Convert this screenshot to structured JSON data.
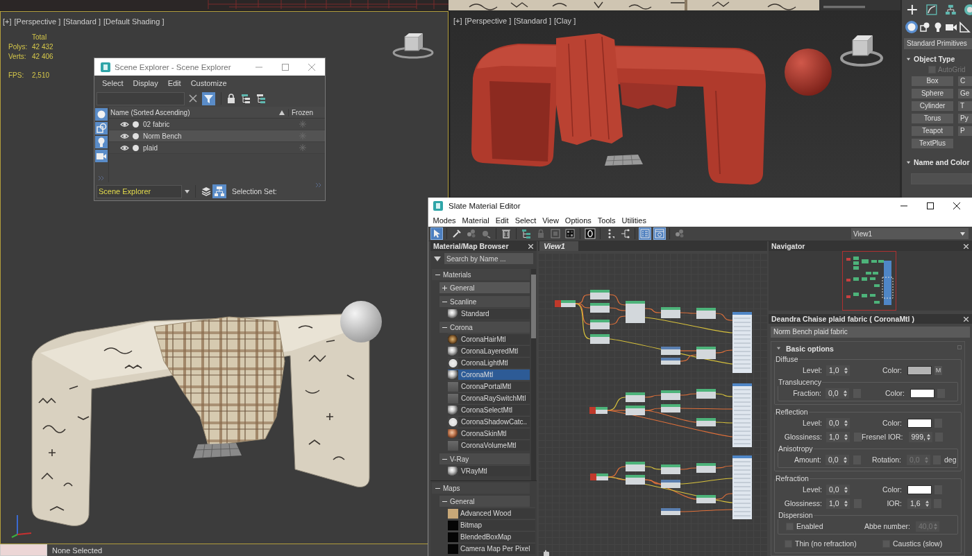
{
  "left_viewport": {
    "labels": [
      "[+]",
      "[Perspective ]",
      "[Standard ]",
      "[Default Shading ]"
    ],
    "active": true,
    "stats": {
      "header": "Total",
      "counts": [
        {
          "label": "Polys:",
          "value": "42 432"
        },
        {
          "label": "Verts:",
          "value": "42 406"
        }
      ],
      "fps": {
        "label": "FPS:",
        "value": "2,510"
      }
    }
  },
  "right_viewport": {
    "labels": [
      "[+]",
      "[Perspective ]",
      "[Standard ]",
      "[Clay ]"
    ],
    "active": false
  },
  "command_panel": {
    "categories": [
      {
        "kind": "geometry",
        "selected": true
      },
      {
        "kind": "shapes",
        "selected": false
      },
      {
        "kind": "lights",
        "selected": false
      },
      {
        "kind": "cameras",
        "selected": false
      },
      {
        "kind": "helpers",
        "selected": false
      }
    ],
    "dropdown": "Standard Primitives",
    "object_type": {
      "title": "Object Type",
      "expanded": true,
      "autogrid": {
        "label": "AutoGrid",
        "checked": false,
        "disabled": true
      },
      "buttons": [
        "Box",
        "C",
        "Sphere",
        "Ge",
        "Cylinder",
        "T",
        "Torus",
        "Py",
        "Teapot",
        "P",
        "TextPlus"
      ]
    },
    "name_and_color": {
      "title": "Name and Color",
      "expanded": true
    }
  },
  "status_bar": {
    "selection": "None Selected"
  },
  "scene_explorer": {
    "title": "Scene Explorer - Scene Explorer",
    "menu": [
      "Select",
      "Display",
      "Edit",
      "Customize"
    ],
    "filter_on": true,
    "side_filters": [
      {
        "kind": "geometry",
        "selected": true
      },
      {
        "kind": "shapes",
        "selected": true
      },
      {
        "kind": "lights",
        "selected": true
      },
      {
        "kind": "cameras",
        "selected": true
      }
    ],
    "columns": {
      "name": "Name (Sorted Ascending)",
      "frozen": "Frozen"
    },
    "rows": [
      {
        "name": "02 fabric",
        "selected": false
      },
      {
        "name": "Norm Bench",
        "selected": true
      },
      {
        "name": "plaid",
        "selected": false
      }
    ],
    "footer": {
      "explorer": "Scene Explorer",
      "hierarchy_on": true,
      "selection_set": "Selection Set:"
    }
  },
  "slate_editor": {
    "title": "Slate Material Editor",
    "menu": [
      "Modes",
      "Material",
      "Edit",
      "Select",
      "View",
      "Options",
      "Tools",
      "Utilities"
    ],
    "toolbar": {
      "groups": [
        [
          {
            "kind": "select",
            "on": true
          }
        ],
        [
          {
            "kind": "eyedropper",
            "on": false
          },
          {
            "kind": "pick",
            "on": false
          },
          {
            "kind": "assign",
            "on": false
          }
        ],
        [
          {
            "kind": "delete",
            "on": false
          }
        ],
        [
          {
            "kind": "move-children",
            "on": false
          },
          {
            "kind": "lock",
            "on": false
          },
          {
            "kind": "background",
            "on": false
          },
          {
            "kind": "checker",
            "on": false
          }
        ],
        [
          {
            "kind": "preview",
            "on": false
          }
        ],
        [
          {
            "kind": "layout",
            "on": false
          },
          {
            "kind": "layout-children",
            "on": false
          }
        ],
        [
          {
            "kind": "params",
            "on": true
          },
          {
            "kind": "selected-view",
            "on": true
          }
        ],
        [
          {
            "kind": "pick",
            "on": false
          }
        ]
      ],
      "view_dropdown": "View1"
    },
    "browser": {
      "title": "Material/Map Browser",
      "search_placeholder": "Search by Name ...",
      "tree": [
        {
          "label": "Materials",
          "expanded": true,
          "children": [
            {
              "label": "General",
              "expanded": false
            },
            {
              "label": "Scanline",
              "expanded": true,
              "children": [
                {
                  "label": "Standard",
                  "kind": "sphere",
                  "selected": false
                }
              ]
            },
            {
              "label": "Corona",
              "expanded": true,
              "children": [
                {
                  "label": "CoronaHairMtl",
                  "kind": "hair",
                  "selected": false
                },
                {
                  "label": "CoronaLayeredMtl",
                  "kind": "sphere",
                  "selected": false
                },
                {
                  "label": "CoronaLightMtl",
                  "kind": "glow",
                  "selected": false
                },
                {
                  "label": "CoronaMtl",
                  "kind": "sphere",
                  "selected": true
                },
                {
                  "label": "CoronaPortalMtl",
                  "kind": "flat",
                  "selected": false
                },
                {
                  "label": "CoronaRaySwitchMtl",
                  "kind": "flat",
                  "selected": false
                },
                {
                  "label": "CoronaSelectMtl",
                  "kind": "sphere",
                  "selected": false
                },
                {
                  "label": "CoronaShadowCatc..",
                  "kind": "glow",
                  "selected": false
                },
                {
                  "label": "CoronaSkinMtl",
                  "kind": "skin",
                  "selected": false
                },
                {
                  "label": "CoronaVolumeMtl",
                  "kind": "flat",
                  "selected": false
                }
              ]
            },
            {
              "label": "V-Ray",
              "expanded": true,
              "children": [
                {
                  "label": "VRayMtl",
                  "kind": "sphere",
                  "selected": false
                }
              ]
            }
          ]
        },
        {
          "label": "Maps",
          "expanded": true,
          "children": [
            {
              "label": "General",
              "expanded": true,
              "children": [
                {
                  "label": "Advanced Wood",
                  "kind": "wood",
                  "selected": false
                },
                {
                  "label": "Bitmap",
                  "kind": "black",
                  "selected": false
                },
                {
                  "label": "BlendedBoxMap",
                  "kind": "black",
                  "selected": false
                },
                {
                  "label": "Camera Map Per Pixel",
                  "kind": "black",
                  "selected": false
                }
              ]
            }
          ]
        }
      ]
    },
    "view_tab": "View1",
    "navigator": {
      "title": "Navigator"
    },
    "parameters": {
      "title": "Deandra Chaise plaid fabric ( CoronaMtl )",
      "name": "Norm Bench plaid fabric",
      "rollout": {
        "title": "Basic options",
        "expanded": true,
        "groups": [
          {
            "title": "Diffuse",
            "rows": [
              [
                {
                  "kind": "spinner",
                  "label": "Level:",
                  "value": "1,0",
                  "slot": false,
                  "disabled": false
                },
                {
                  "kind": "color",
                  "label": "Color:",
                  "color": "#b4b4b4",
                  "slot": true,
                  "map": "M"
                }
              ]
            ],
            "sub": {
              "title": "Translucency",
              "rows": [
                [
                  {
                    "kind": "spinner",
                    "label": "Fraction:",
                    "value": "0,0",
                    "slot": true,
                    "disabled": false
                  },
                  {
                    "kind": "color",
                    "label": "Color:",
                    "color": "#ffffff",
                    "slot": true
                  }
                ]
              ]
            }
          },
          {
            "title": "Reflection",
            "rows": [
              [
                {
                  "kind": "spinner",
                  "label": "Level:",
                  "value": "0,0",
                  "slot": false,
                  "disabled": false
                },
                {
                  "kind": "color",
                  "label": "Color:",
                  "color": "#ffffff",
                  "slot": true
                }
              ],
              [
                {
                  "kind": "spinner",
                  "label": "Glossiness:",
                  "value": "1,0",
                  "slot": true,
                  "disabled": false
                },
                {
                  "kind": "spinner",
                  "label": "Fresnel IOR:",
                  "value": "999,",
                  "slot": true,
                  "disabled": false
                }
              ]
            ],
            "sub": {
              "title": "Anisotropy",
              "rows": [
                [
                  {
                    "kind": "spinner",
                    "label": "Amount:",
                    "value": "0,0",
                    "slot": true,
                    "disabled": false
                  },
                  {
                    "kind": "spinner",
                    "label": "Rotation:",
                    "value": "0,0",
                    "slot": true,
                    "disabled": true,
                    "unit": "deg"
                  }
                ]
              ]
            }
          },
          {
            "title": "Refraction",
            "rows": [
              [
                {
                  "kind": "spinner",
                  "label": "Level:",
                  "value": "0,0",
                  "slot": false,
                  "disabled": false
                },
                {
                  "kind": "color",
                  "label": "Color:",
                  "color": "#ffffff",
                  "slot": true
                }
              ],
              [
                {
                  "kind": "spinner",
                  "label": "Glossiness:",
                  "value": "1,0",
                  "slot": true,
                  "disabled": false
                },
                {
                  "kind": "spinner",
                  "label": "IOR:",
                  "value": "1,6",
                  "slot": true,
                  "disabled": false
                }
              ]
            ],
            "sub": {
              "title": "Dispersion",
              "rows": [
                [
                  {
                    "kind": "checkbox",
                    "label": "Enabled",
                    "checked": false
                  },
                  {
                    "kind": "spinner",
                    "label": "Abbe number:",
                    "value": "40,0",
                    "slot": false,
                    "disabled": true
                  }
                ]
              ]
            },
            "checks": [
              {
                "label": "Thin (no refraction)",
                "checked": false
              },
              {
                "label": "Caustics (slow)",
                "checked": false
              }
            ]
          }
        ]
      }
    }
  }
}
